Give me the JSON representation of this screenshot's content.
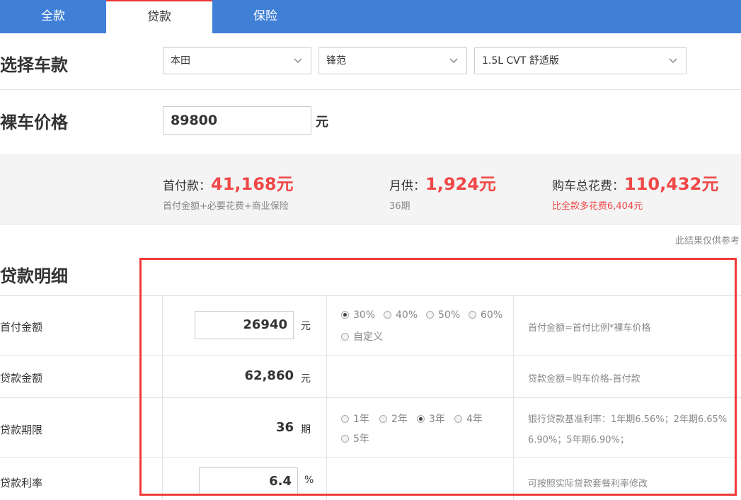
{
  "tabs": [
    "全款",
    "贷款",
    "保险"
  ],
  "select_car": {
    "label": "选择车款",
    "brand": "本田",
    "series": "锋范",
    "model": "1.5L CVT 舒适版"
  },
  "price": {
    "label": "裸车价格",
    "value": "89800",
    "unit": "元"
  },
  "summary": {
    "down": {
      "label": "首付款：",
      "value": "41,168元",
      "sub": "首付金额+必要花费+商业保险"
    },
    "monthly": {
      "label": "月供：",
      "value": "1,924元",
      "sub": "36期"
    },
    "total": {
      "label": "购车总花费：",
      "value": "110,432元",
      "sub": "比全款多花费6,404元"
    }
  },
  "note": "此结果仅供参考",
  "loan": {
    "title": "贷款明细",
    "rows": {
      "down_payment": {
        "label": "首付金额",
        "value": "26940",
        "unit": "元",
        "options": [
          "30%",
          "40%",
          "50%",
          "60%",
          "自定义"
        ],
        "selected": "30%",
        "desc": "首付金额=首付比例*裸车价格"
      },
      "loan_amount": {
        "label": "贷款金额",
        "value": "62,860",
        "unit": "元",
        "desc": "贷款金额=购车价格-首付款"
      },
      "term": {
        "label": "贷款期限",
        "value": "36",
        "unit": "期",
        "options": [
          "1年",
          "2年",
          "3年",
          "4年",
          "5年"
        ],
        "selected": "3年",
        "desc1": "银行贷款基准利率：1年期6.56%；2年期6.65%",
        "desc2": "6.90%；5年期6.90%；"
      },
      "rate": {
        "label": "贷款利率",
        "value": "6.4",
        "unit": "%",
        "desc": "可按照实际贷款套餐利率修改"
      }
    }
  },
  "colors": {
    "tab_bg": "#3f7fd6",
    "accent_red": "#f04848",
    "highlight_box": "#f03a3a"
  }
}
